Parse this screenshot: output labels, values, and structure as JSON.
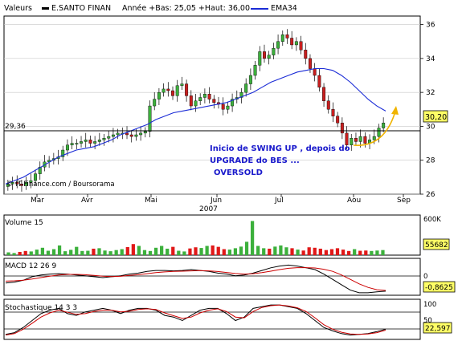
{
  "header": {
    "label_valeurs": "Valeurs",
    "security_name": "E.SANTO FINAN",
    "stats": "Année +Bas: 25,05 +Haut: 36,00",
    "ema_label": "EMA34"
  },
  "colors": {
    "up_candle": "#3cb03c",
    "down_candle": "#c81e1e",
    "ema_line": "#1a2bd6",
    "volume_up": "#3cb03c",
    "volume_down": "#e01818",
    "macd_line": "#000000",
    "macd_signal": "#cc0000",
    "stoch_k": "#000000",
    "stoch_d": "#cc0000",
    "annotation_text": "#1a1acc",
    "annotation_arrow": "#f0b400",
    "price_box": "#ffff66"
  },
  "annotation": {
    "line1": "Inicio de SWING UP , depois do",
    "line2": "UPGRADE do BES ...",
    "line3": "OVERSOLD"
  },
  "watermark": "© IT-Finance.com / Boursorama",
  "chart_data": [
    {
      "type": "candlestick",
      "title": "E.SANTO FINAN",
      "ylim": [
        26,
        36.5
      ],
      "yticks": [
        "26",
        "28",
        "30",
        "32",
        "34",
        "36"
      ],
      "xticks": [
        "Mar",
        "Avr",
        "Mai",
        "Jun",
        "Jul",
        "Aou",
        "Sep"
      ],
      "xlabel": "2007",
      "reference_line": {
        "label": "29,36",
        "value": 29.36
      },
      "last_value": "30,20",
      "series": [
        {
          "name": "price",
          "close": [
            26.6,
            26.7,
            26.6,
            26.5,
            26.7,
            26.8,
            27.2,
            27.6,
            27.9,
            28.0,
            28.1,
            28.2,
            28.6,
            28.9,
            29.0,
            29.0,
            29.1,
            29.2,
            29.0,
            29.1,
            29.2,
            29.3,
            29.4,
            29.5,
            29.6,
            29.6,
            29.5,
            29.4,
            29.5,
            29.6,
            29.7,
            31.2,
            31.6,
            32.0,
            32.2,
            32.1,
            31.8,
            32.4,
            32.5,
            31.8,
            31.2,
            31.5,
            31.7,
            31.9,
            31.6,
            31.4,
            31.3,
            31.0,
            31.2,
            31.6,
            31.7,
            32.0,
            32.5,
            33.0,
            33.6,
            34.4,
            34.0,
            34.2,
            34.6,
            35.0,
            35.4,
            35.2,
            34.8,
            35.0,
            34.5,
            34.0,
            33.4,
            33.0,
            32.3,
            31.5,
            31.0,
            30.6,
            30.2,
            29.6,
            28.9,
            29.3,
            29.1,
            29.4,
            29.0,
            29.2,
            29.4,
            29.9,
            30.2
          ]
        },
        {
          "name": "EMA34",
          "values": [
            26.6,
            26.8,
            27.0,
            27.3,
            27.6,
            27.9,
            28.2,
            28.4,
            28.6,
            28.7,
            28.8,
            29.0,
            29.2,
            29.5,
            29.7,
            29.9,
            30.1,
            30.4,
            30.6,
            30.8,
            30.9,
            31.0,
            31.1,
            31.2,
            31.3,
            31.4,
            31.6,
            31.8,
            32.0,
            32.3,
            32.6,
            32.8,
            33.0,
            33.2,
            33.3,
            33.4,
            33.4,
            33.3,
            33.0,
            32.6,
            32.1,
            31.6,
            31.2,
            30.9
          ]
        }
      ]
    },
    {
      "type": "bar",
      "title": "Volume 15",
      "yticks": [
        "600K"
      ],
      "last_value": "55682",
      "values": [
        60,
        45,
        70,
        90,
        80,
        120,
        160,
        95,
        130,
        210,
        85,
        115,
        180,
        90,
        95,
        140,
        150,
        100,
        85,
        110,
        130,
        175,
        240,
        200,
        110,
        90,
        160,
        200,
        140,
        180,
        95,
        80,
        145,
        170,
        155,
        200,
        210,
        180,
        130,
        120,
        150,
        185,
        290,
        740,
        200,
        150,
        140,
        185,
        210,
        170,
        150,
        120,
        100,
        170,
        160,
        140,
        110,
        130,
        150,
        120,
        90,
        130,
        95,
        100,
        90,
        100,
        110
      ]
    },
    {
      "type": "line",
      "title": "MACD 12 26 9",
      "yticks": [
        "0"
      ],
      "last_value": "-0,8625",
      "series": [
        {
          "name": "MACD",
          "values": [
            -0.4,
            -0.35,
            -0.25,
            -0.05,
            0.05,
            0.1,
            0.12,
            0.1,
            0.05,
            0.0,
            -0.05,
            -0.1,
            -0.05,
            0.0,
            0.1,
            0.15,
            0.25,
            0.3,
            0.3,
            0.28,
            0.3,
            0.35,
            0.3,
            0.25,
            0.15,
            0.1,
            0.0,
            0.05,
            0.15,
            0.3,
            0.45,
            0.55,
            0.6,
            0.55,
            0.45,
            0.35,
            0.1,
            -0.2,
            -0.5,
            -0.8,
            -0.95,
            -0.95,
            -0.9,
            -0.86
          ]
        },
        {
          "name": "Signal",
          "values": [
            -0.3,
            -0.28,
            -0.25,
            -0.18,
            -0.1,
            -0.02,
            0.05,
            0.08,
            0.08,
            0.06,
            0.02,
            -0.02,
            -0.04,
            -0.03,
            0.02,
            0.06,
            0.12,
            0.18,
            0.22,
            0.25,
            0.26,
            0.28,
            0.29,
            0.28,
            0.24,
            0.19,
            0.13,
            0.1,
            0.12,
            0.18,
            0.26,
            0.35,
            0.42,
            0.46,
            0.46,
            0.44,
            0.37,
            0.25,
            0.05,
            -0.2,
            -0.45,
            -0.65,
            -0.78,
            -0.82
          ]
        }
      ]
    },
    {
      "type": "line",
      "title": "Stochastique 14 3 3",
      "ylim": [
        0,
        100
      ],
      "yticks": [
        "100",
        "50"
      ],
      "last_value": "22,597",
      "series": [
        {
          "name": "%K",
          "values": [
            10,
            15,
            30,
            50,
            70,
            80,
            85,
            70,
            65,
            75,
            80,
            85,
            80,
            70,
            80,
            85,
            85,
            80,
            65,
            60,
            50,
            65,
            80,
            85,
            85,
            70,
            50,
            60,
            85,
            90,
            95,
            95,
            90,
            85,
            70,
            50,
            30,
            20,
            12,
            8,
            10,
            12,
            18,
            25
          ]
        },
        {
          "name": "%D",
          "values": [
            8,
            12,
            25,
            42,
            60,
            72,
            80,
            74,
            68,
            70,
            76,
            80,
            80,
            75,
            77,
            82,
            84,
            82,
            72,
            64,
            56,
            60,
            72,
            80,
            84,
            76,
            60,
            58,
            76,
            88,
            93,
            95,
            92,
            87,
            76,
            58,
            38,
            25,
            16,
            11,
            10,
            11,
            15,
            22
          ]
        }
      ]
    }
  ]
}
